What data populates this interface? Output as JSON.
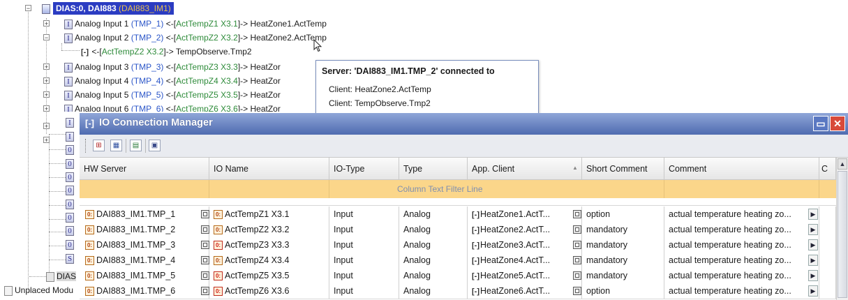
{
  "tree": {
    "root": {
      "name": "DIAS:0, DAI883",
      "alias": "(DAI883_IM1)"
    },
    "items": [
      {
        "label": "Analog Input 1",
        "tmp": "(TMP_1)",
        "pre": "<-[",
        "link": "ActTempZ1 X3.1",
        "post": "]-> HeatZone1.ActTemp"
      },
      {
        "label": "Analog Input 2",
        "tmp": "(TMP_2)",
        "pre": "<-[",
        "link": "ActTempZ2 X3.2",
        "post": "]-> HeatZone2.ActTemp"
      },
      {
        "label": "Analog Input 3",
        "tmp": "(TMP_3)",
        "pre": "<-[",
        "link": "ActTempZ3 X3.3",
        "post": "]-> HeatZor"
      },
      {
        "label": "Analog Input 4",
        "tmp": "(TMP_4)",
        "pre": "<-[",
        "link": "ActTempZ4 X3.4",
        "post": "]-> HeatZor"
      },
      {
        "label": "Analog Input 5",
        "tmp": "(TMP_5)",
        "pre": "<-[",
        "link": "ActTempZ5 X3.5",
        "post": "]-> HeatZor"
      },
      {
        "label": "Analog Input 6",
        "tmp": "(TMP_6)",
        "pre": "<-[",
        "link": "ActTempZ6 X3.6",
        "post": "]-> HeatZor"
      }
    ],
    "sub_item": {
      "pre": "<-[",
      "link": "ActTempZ2 X3.2",
      "post": "]-> TempObserve.Tmp2"
    },
    "left_icons": [
      "I",
      "I",
      "0",
      "0",
      "0",
      "0",
      "0",
      "0",
      "0",
      "0",
      "S"
    ],
    "dias_partial": "DIAS",
    "unplaced": "Unplaced Modu"
  },
  "tooltip": {
    "title": "Server: 'DAI883_IM1.TMP_2' connected to",
    "lines": [
      "Client: HeatZone2.ActTemp",
      "Client: TempObserve.Tmp2"
    ]
  },
  "window": {
    "title": "IO Connection Manager",
    "columns": [
      "HW Server",
      "IO Name",
      "IO-Type",
      "Type",
      "App. Client",
      "Short Comment",
      "Comment",
      "C"
    ],
    "filter_text": "Column Text Filter Line",
    "rows": [
      {
        "hw": "DAI883_IM1.TMP_1",
        "io": "ActTempZ1 X3.1",
        "iotype": "Input",
        "type": "Analog",
        "client": "HeatZone1.ActT...",
        "short": "option",
        "comment": "actual temperature heating zo...",
        "red": false
      },
      {
        "hw": "DAI883_IM1.TMP_2",
        "io": "ActTempZ2 X3.2",
        "iotype": "Input",
        "type": "Analog",
        "client": "HeatZone2.ActT...",
        "short": "mandatory",
        "comment": "actual temperature heating zo...",
        "red": false
      },
      {
        "hw": "DAI883_IM1.TMP_3",
        "io": "ActTempZ3 X3.3",
        "iotype": "Input",
        "type": "Analog",
        "client": "HeatZone3.ActT...",
        "short": "mandatory",
        "comment": "actual temperature heating zo...",
        "red": true
      },
      {
        "hw": "DAI883_IM1.TMP_4",
        "io": "ActTempZ4 X3.4",
        "iotype": "Input",
        "type": "Analog",
        "client": "HeatZone4.ActT...",
        "short": "mandatory",
        "comment": "actual temperature heating zo...",
        "red": false
      },
      {
        "hw": "DAI883_IM1.TMP_5",
        "io": "ActTempZ5 X3.5",
        "iotype": "Input",
        "type": "Analog",
        "client": "HeatZone5.ActT...",
        "short": "mandatory",
        "comment": "actual temperature heating zo...",
        "red": true
      },
      {
        "hw": "DAI883_IM1.TMP_6",
        "io": "ActTempZ6 X3.6",
        "iotype": "Input",
        "type": "Analog",
        "client": "HeatZone6.ActT...",
        "short": "option",
        "comment": "actual temperature heating zo...",
        "red": true
      }
    ]
  }
}
